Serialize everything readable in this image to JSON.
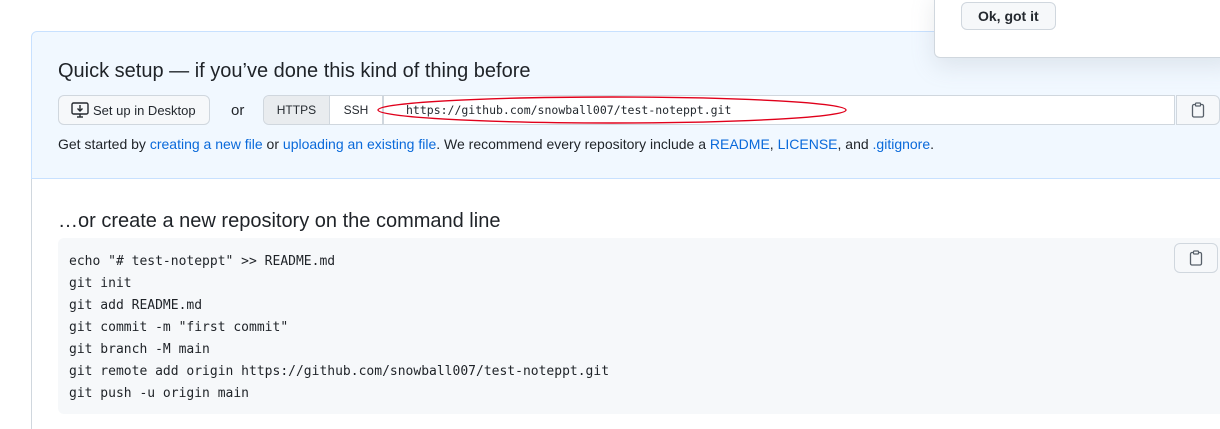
{
  "popover": {
    "ok_label": "Ok, got it"
  },
  "quick_setup": {
    "title": "Quick setup — if you’ve done this kind of thing before",
    "desktop_label": "Set up in Desktop",
    "or_text": "or",
    "protocols": [
      "HTTPS",
      "SSH"
    ],
    "selected_protocol": "HTTPS",
    "clone_url": "https://github.com/snowball007/test-noteppt.git",
    "get_started": {
      "t1": "Get started by ",
      "link1": "creating a new file",
      "t2": " or ",
      "link2": "uploading an existing file",
      "t3": ". We recommend every repository include a ",
      "link3": "README",
      "t4": ", ",
      "link4": "LICENSE",
      "t5": ", and ",
      "link5": ".gitignore",
      "t6": "."
    }
  },
  "command_line": {
    "title": "…or create a new repository on the command line",
    "lines": [
      "echo \"# test-noteppt\" >> README.md",
      "git init",
      "git add README.md",
      "git commit -m \"first commit\"",
      "git branch -M main",
      "git remote add origin https://github.com/snowball007/test-noteppt.git",
      "git push -u origin main"
    ]
  },
  "colors": {
    "link": "#0969da",
    "annotation": "#e0001b",
    "quick_bg": "#f1f8ff"
  },
  "icons": {
    "desktop": "desktop-download-icon",
    "copy": "clipboard-copy-icon"
  }
}
